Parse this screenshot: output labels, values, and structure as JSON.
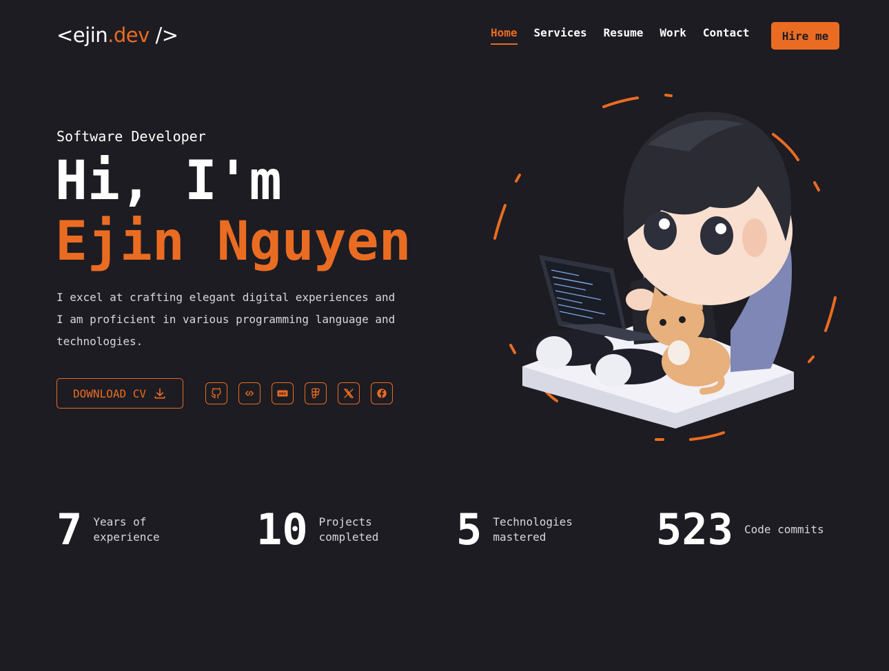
{
  "logo": {
    "prefix": "<ejin",
    "accent": ".dev",
    "suffix": " />"
  },
  "nav": {
    "items": [
      {
        "label": "Home",
        "active": true
      },
      {
        "label": "Services",
        "active": false
      },
      {
        "label": "Resume",
        "active": false
      },
      {
        "label": "Work",
        "active": false
      },
      {
        "label": "Contact",
        "active": false
      }
    ],
    "cta": "Hire me"
  },
  "hero": {
    "role": "Software Developer",
    "greeting": "Hi, I'm",
    "name": "Ejin Nguyen",
    "description": "I excel at crafting elegant digital experiences and I am proficient in various programming language and technologies.",
    "download_label": "DOWNLOAD CV",
    "download_icon": "download-icon",
    "socials": [
      {
        "name": "github-icon"
      },
      {
        "name": "code-icon"
      },
      {
        "name": "dev-to-icon"
      },
      {
        "name": "figma-icon"
      },
      {
        "name": "x-icon"
      },
      {
        "name": "facebook-icon"
      }
    ],
    "illustration": "developer-avatar-with-laptop-and-cat"
  },
  "stats": [
    {
      "value": "7",
      "label": "Years of experience"
    },
    {
      "value": "10",
      "label": "Projects completed"
    },
    {
      "value": "5",
      "label": "Technologies mastered"
    },
    {
      "value": "523",
      "label": "Code commits"
    }
  ],
  "colors": {
    "background": "#1d1c22",
    "accent": "#ea6c22",
    "text": "#ffffff"
  }
}
